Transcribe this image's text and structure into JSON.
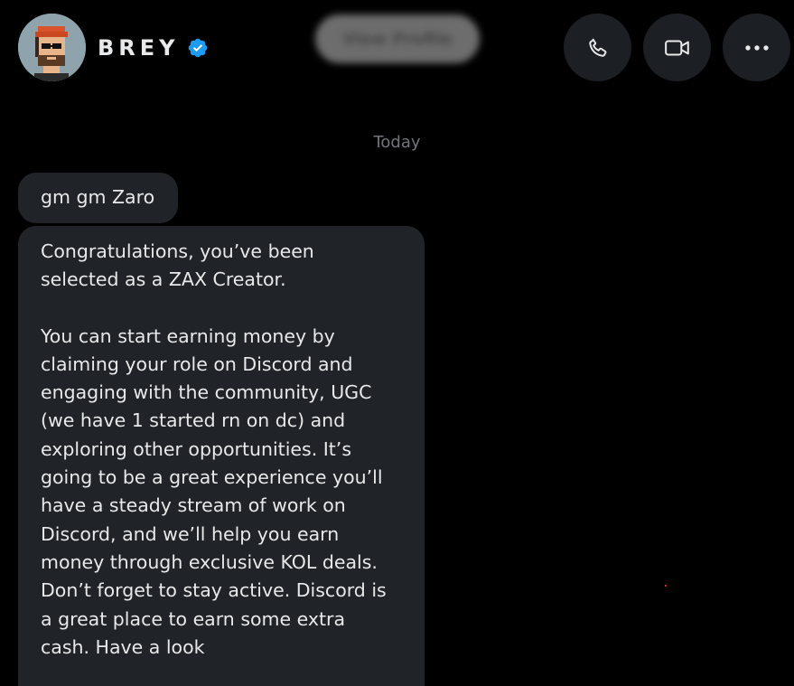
{
  "header": {
    "contact_name": "BREY",
    "verified_icon": "verified-badge-icon",
    "view_profile_label": "View Profile",
    "actions": [
      {
        "name": "call",
        "icon": "phone-icon"
      },
      {
        "name": "video",
        "icon": "video-camera-icon"
      },
      {
        "name": "more",
        "icon": "more-horizontal-icon"
      }
    ]
  },
  "conversation": {
    "date_separator": "Today",
    "messages": [
      {
        "text": "gm gm Zaro"
      },
      {
        "paragraphs": [
          "Congratulations, you’ve been\nselected as a ZAX Creator.",
          "You can start earning money by\nclaiming your role on Discord and\nengaging with the community, UGC\n(we have 1 started rn on dc) and\nexploring other opportunities. It’s\ngoing to be a great experience you’ll\nhave a steady stream of work on\nDiscord, and we’ll help you earn\nmoney through exclusive KOL deals.\nDon’t forget to stay active. Discord is\na great place to earn some extra\ncash. Have a look"
        ]
      }
    ]
  },
  "colors": {
    "background": "#000000",
    "bubble": "#202327",
    "text": "#e7e9ea",
    "muted": "#71767b",
    "verified": "#1d9bf0",
    "button": "#1c1f23"
  }
}
